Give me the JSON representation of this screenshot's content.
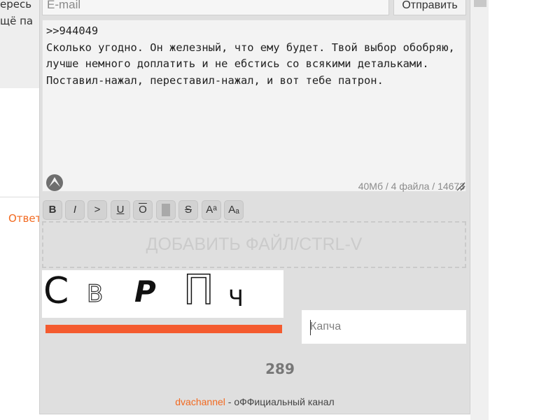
{
  "background": {
    "post_text_line1": "ересь",
    "post_text_line2": "щё па",
    "reply_link": "Ответ"
  },
  "form": {
    "email": {
      "placeholder": "E-mail"
    },
    "send_label": "Отправить",
    "comment": {
      "text": ">>944049\nСколько угодно. Он железный, что ему будет. Твой выбор обобряю,\nлучше немного доплатить и не ебстись со всякими детальками.\nПоставил-нажал, переставил-нажал, и вот тебе патрон."
    },
    "limits": "40Мб / 4 файла / 14673",
    "markup_buttons": [
      "B",
      "I",
      ">",
      "U",
      "O",
      "",
      "S",
      "Aᵃ",
      "Aₐ"
    ],
    "dropzone_label": "ДОБАВИТЬ ФАЙЛ/CTRL-V",
    "captcha": {
      "chars": [
        "С",
        "В",
        "Р",
        "П",
        "Ч"
      ],
      "input_placeholder": "Капча",
      "bar_color": "#f45b2f"
    },
    "counter": "289"
  },
  "footer": {
    "link": "dvachannel",
    "text": " - оФФициальный канал"
  },
  "colors": {
    "accent": "#f26a21",
    "panel_bg": "#dfdfdf"
  },
  "icons": [
    "sage-icon",
    "resize-icon"
  ]
}
